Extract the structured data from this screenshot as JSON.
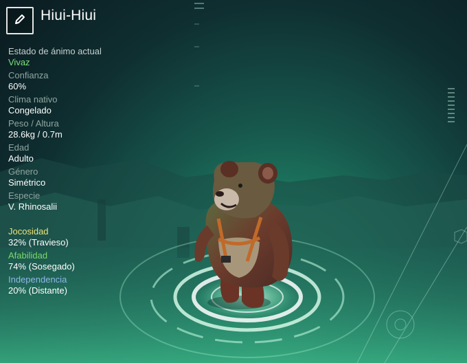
{
  "creature": {
    "name": "Hiui-Hiui",
    "edit_icon": "pencil-icon"
  },
  "stats": [
    {
      "label": "Estado de ánimo actual",
      "value": "Vivaz"
    },
    {
      "label": "Confianza",
      "value": "60%"
    },
    {
      "label": "Clima nativo",
      "value": "Congelado"
    },
    {
      "label": "Peso / Altura",
      "value": "28.6kg / 0.7m"
    },
    {
      "label": "Edad",
      "value": "Adulto"
    },
    {
      "label": "Género",
      "value": "Simétrico"
    },
    {
      "label": "Especie",
      "value": "V. Rhinosalii"
    }
  ],
  "traits": [
    {
      "label": "Jocosidad",
      "value": "32% (Travieso)",
      "color": "#e8e27a"
    },
    {
      "label": "Afabilidad",
      "value": "74% (Sosegado)",
      "color": "#7bd96a"
    },
    {
      "label": "Independencia",
      "value": "20% (Distante)",
      "color": "#8fb6e8"
    }
  ],
  "colors": {
    "mood": "#7be07c",
    "platform_glow": "#dfffee"
  }
}
